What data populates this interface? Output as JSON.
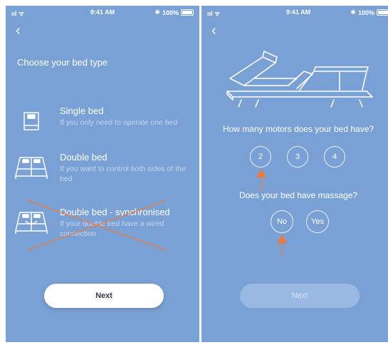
{
  "status_bar": {
    "signal": "ııl ᯤ",
    "time": "9:41 AM",
    "bluetooth": "✱",
    "battery": "100%"
  },
  "left_screen": {
    "title": "Choose your bed type",
    "options": [
      {
        "title": "Single bed",
        "description": "If you only need to operate one bed",
        "icon": "single-bed-icon"
      },
      {
        "title": "Double bed",
        "description": "If you want to control both sides of the bed",
        "icon": "double-bed-icon"
      },
      {
        "title": "Double bed - synchronised",
        "description": "If your double bed have a wired connection",
        "icon": "synchronised-bed-icon",
        "crossed_out": true
      }
    ],
    "next_label": "Next"
  },
  "right_screen": {
    "motors_question": "How many motors does your bed have?",
    "motor_options": [
      "2",
      "3",
      "4"
    ],
    "massage_question": "Does your bed have massage?",
    "massage_options": [
      "No",
      "Yes"
    ],
    "next_label": "Next",
    "next_disabled": true
  },
  "colors": {
    "background": "#7aa1d6",
    "annotation": "#ee7a3a",
    "button": "#ffffff",
    "disabled_button": "#9ab9e2"
  }
}
